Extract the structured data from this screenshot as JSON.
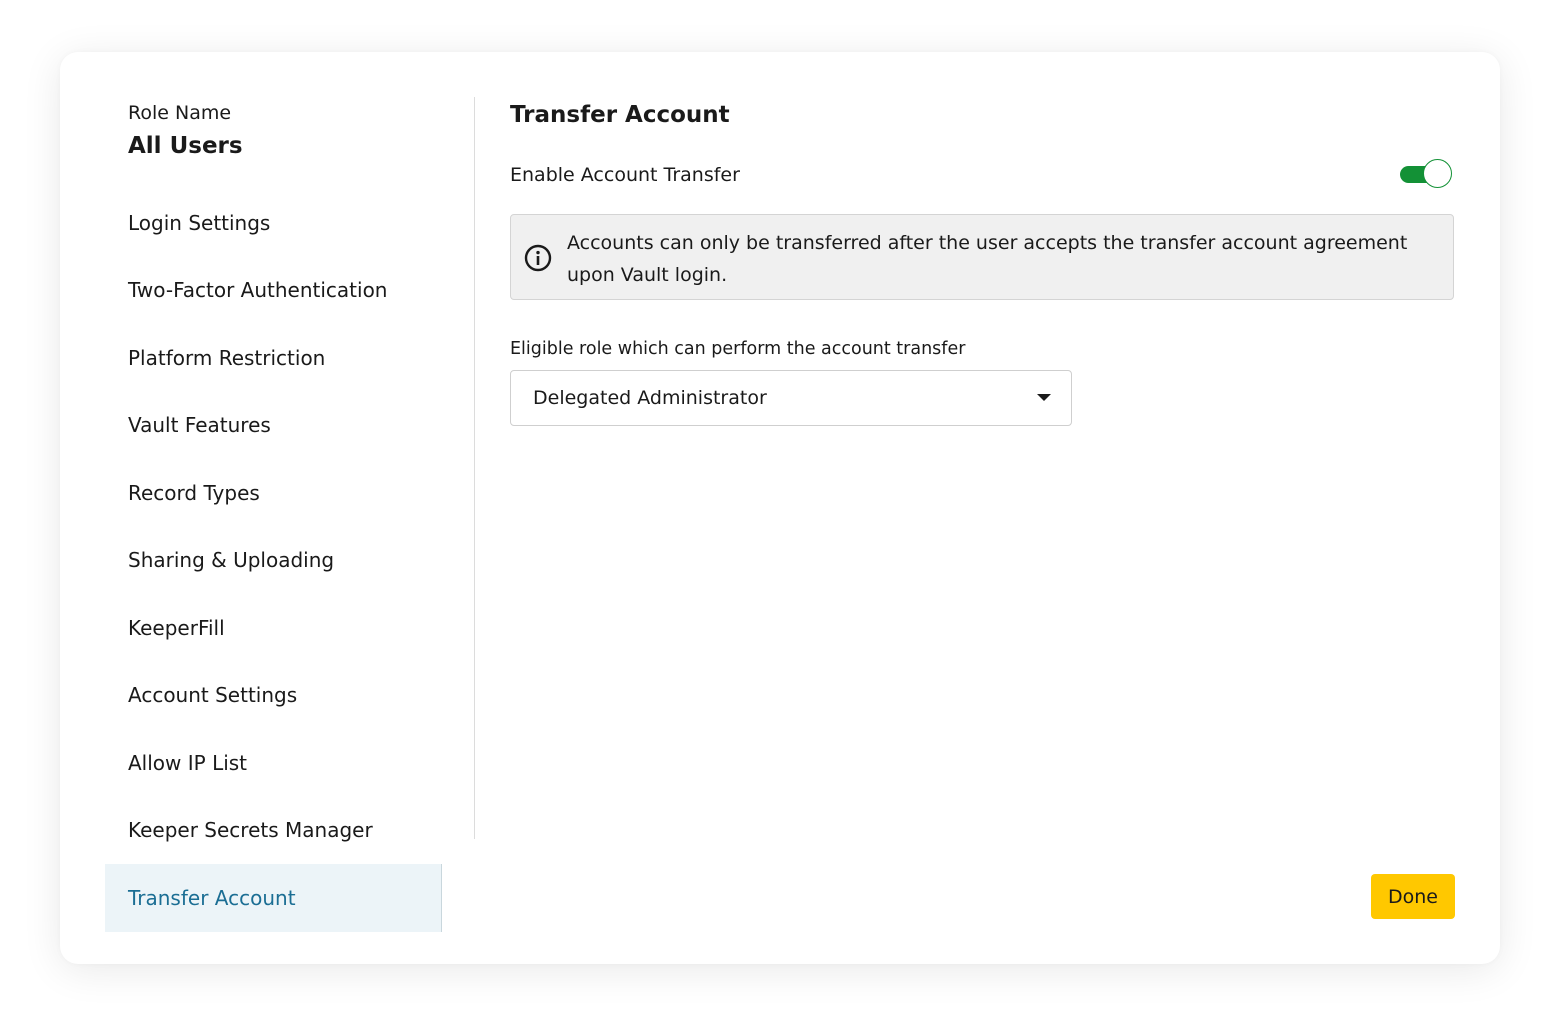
{
  "sidebar": {
    "role_label": "Role Name",
    "role_name": "All Users",
    "items": [
      {
        "label": "Login Settings"
      },
      {
        "label": "Two-Factor Authentication"
      },
      {
        "label": "Platform Restriction"
      },
      {
        "label": "Vault Features"
      },
      {
        "label": "Record Types"
      },
      {
        "label": "Sharing & Uploading"
      },
      {
        "label": "KeeperFill"
      },
      {
        "label": "Account Settings"
      },
      {
        "label": "Allow IP List"
      },
      {
        "label": "Keeper Secrets Manager"
      },
      {
        "label": "Transfer Account",
        "active": true
      }
    ]
  },
  "main": {
    "title": "Transfer Account",
    "toggle_label": "Enable Account Transfer",
    "toggle_on": true,
    "info_icon": "info-circle-icon",
    "info_text": "Accounts can only be transferred after the user accepts the transfer account agreement upon Vault login.",
    "select_label": "Eligible role which can perform the account transfer",
    "select_value": "Delegated Administrator",
    "done_label": "Done"
  },
  "colors": {
    "accent_toggle": "#139136",
    "active_nav_text": "#1b6e94",
    "active_nav_bg": "#ecf4f8",
    "done_button": "#ffc800",
    "info_bg": "#f0f0f0"
  }
}
